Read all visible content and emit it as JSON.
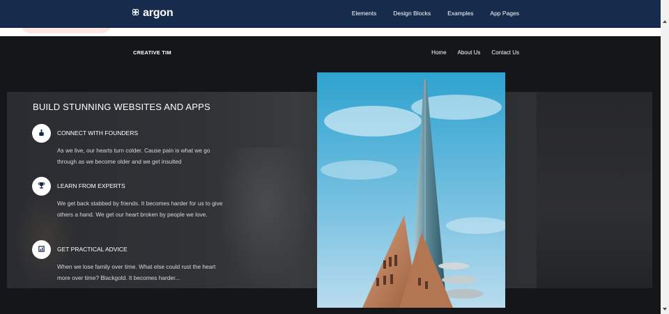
{
  "topnav": {
    "brand": "argon",
    "links": [
      "Elements",
      "Design Blocks",
      "Examples",
      "App Pages"
    ]
  },
  "subnav": {
    "brand": "CREATIVE TIM",
    "links": [
      "Home",
      "About Us",
      "Contact Us"
    ]
  },
  "section": {
    "title": "BUILD STUNNING WEBSITES AND APPS",
    "features": [
      {
        "icon": "hand-point-icon",
        "heading": "CONNECT WITH FOUNDERS",
        "text": "As we live, our hearts turn colder. Cause pain is what we go through as we become older and we get insulted"
      },
      {
        "icon": "trophy-icon",
        "heading": "LEARN FROM EXPERTS",
        "text": "We get back stabbed by friends. It becomes harder for us to give others a hand. We get our heart broken by people we love."
      },
      {
        "icon": "chart-icon",
        "heading": "GET PRACTICAL ADVICE",
        "text": "When we lose family over time. What else could rust the heart more over time? Blackgold. It becomes harder..."
      }
    ]
  },
  "colors": {
    "navbar": "#172b4d",
    "section_bg": "#151619",
    "sky": "#4ab0d6"
  }
}
